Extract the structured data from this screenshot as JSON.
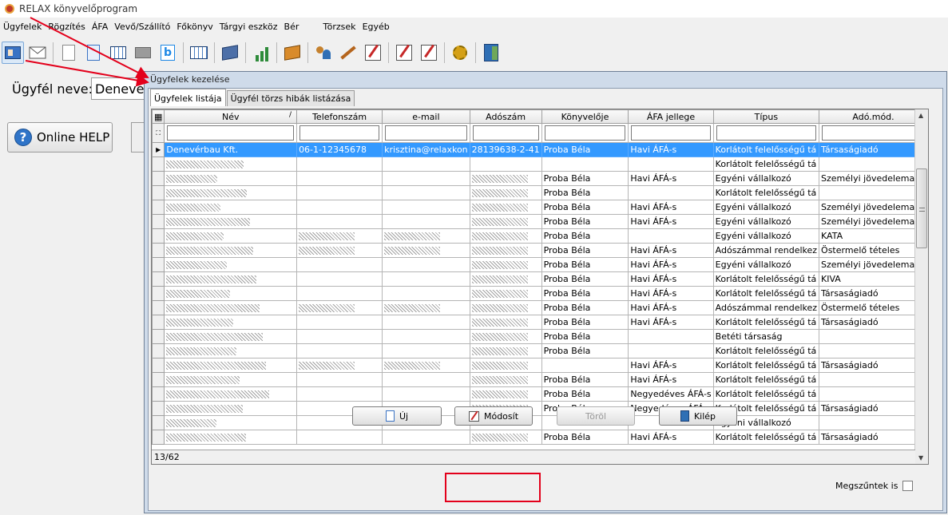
{
  "window": {
    "title": "RELAX könyvelőprogram"
  },
  "menu": [
    "Ügyfelek",
    "Rögzítés",
    "ÁFA",
    "Vevő/Szállító",
    "Főkönyv",
    "Tárgyi eszköz",
    "Bér",
    "Törzsek",
    "Egyéb"
  ],
  "toolbar_icons": [
    "client-card-icon",
    "envelope-icon",
    "document-icon",
    "documents-icon",
    "calculator-icon",
    "grey-box-icon",
    "b-document-icon",
    "table-icon",
    "blue-book-icon",
    "bar-chart-icon",
    "orange-book-icon",
    "people-icon",
    "magic-wand-icon",
    "edit-icon",
    "pen-red-icon",
    "pen-list-icon",
    "gear-icon",
    "exit-door-icon"
  ],
  "client": {
    "label": "Ügyfél neve:",
    "value": "Denevérbau Kft."
  },
  "help": {
    "label": "Online HELP"
  },
  "dialog": {
    "title": "Ügyfelek kezelése",
    "tabs": [
      "Ügyfelek listája",
      "Ügyfél törzs hibák listázása"
    ],
    "columns": [
      "Név",
      "Telefonszám",
      "e-mail",
      "Adószám",
      "Könyvelője",
      "ÁFA jellege",
      "Típus",
      "Adó.mód."
    ],
    "rows": [
      {
        "name": "Denevérbau Kft.",
        "phone": "06-1-12345678",
        "email": "krisztina@relaxkon",
        "tax": "28139638-2-41",
        "bookkeeper": "Proba Béla",
        "vat": "Havi ÁFÁ-s",
        "type": "Korlátolt felelősségű tá",
        "taxmode": "Társaságiadó"
      },
      {
        "name": "",
        "phone": "",
        "email": "",
        "tax": "",
        "bookkeeper": "",
        "vat": "",
        "type": "Korlátolt felelősségű tá",
        "taxmode": ""
      },
      {
        "name": "",
        "phone": "",
        "email": "",
        "tax": "",
        "bookkeeper": "Proba Béla",
        "vat": "Havi ÁFÁ-s",
        "type": "Egyéni vállalkozó",
        "taxmode": "Személyi jövedelemadó"
      },
      {
        "name": "",
        "phone": "",
        "email": "",
        "tax": "",
        "bookkeeper": "Proba Béla",
        "vat": "",
        "type": "Korlátolt felelősségű tá",
        "taxmode": ""
      },
      {
        "name": "",
        "phone": "",
        "email": "",
        "tax": "",
        "bookkeeper": "Proba Béla",
        "vat": "Havi ÁFÁ-s",
        "type": "Egyéni vállalkozó",
        "taxmode": "Személyi jövedelemadó"
      },
      {
        "name": "",
        "phone": "",
        "email": "",
        "tax": "",
        "bookkeeper": "Proba Béla",
        "vat": "Havi ÁFÁ-s",
        "type": "Egyéni vállalkozó",
        "taxmode": "Személyi jövedelemadó"
      },
      {
        "name": "",
        "phone": "",
        "email": "",
        "tax": "",
        "bookkeeper": "Proba Béla",
        "vat": "",
        "type": "Egyéni vállalkozó",
        "taxmode": "KATA"
      },
      {
        "name": "",
        "phone": "",
        "email": "",
        "tax": "",
        "bookkeeper": "Proba Béla",
        "vat": "Havi ÁFÁ-s",
        "type": "Adószámmal rendelkez",
        "taxmode": "Östermelő tételes"
      },
      {
        "name": "",
        "phone": "",
        "email": "",
        "tax": "",
        "bookkeeper": "Proba Béla",
        "vat": "Havi ÁFÁ-s",
        "type": "Egyéni vállalkozó",
        "taxmode": "Személyi jövedelemadó"
      },
      {
        "name": "",
        "phone": "",
        "email": "",
        "tax": "",
        "bookkeeper": "Proba Béla",
        "vat": "Havi ÁFÁ-s",
        "type": "Korlátolt felelősségű tá",
        "taxmode": "KIVA"
      },
      {
        "name": "",
        "phone": "",
        "email": "",
        "tax": "",
        "bookkeeper": "Proba Béla",
        "vat": "Havi ÁFÁ-s",
        "type": "Korlátolt felelősségű tá",
        "taxmode": "Társaságiadó"
      },
      {
        "name": "",
        "phone": "",
        "email": "",
        "tax": "",
        "bookkeeper": "Proba Béla",
        "vat": "Havi ÁFÁ-s",
        "type": "Adószámmal rendelkez",
        "taxmode": "Östermelő tételes"
      },
      {
        "name": "",
        "phone": "",
        "email": "",
        "tax": "",
        "bookkeeper": "Proba Béla",
        "vat": "Havi ÁFÁ-s",
        "type": "Korlátolt felelősségű tá",
        "taxmode": "Társaságiadó"
      },
      {
        "name": "",
        "phone": "",
        "email": "",
        "tax": "",
        "bookkeeper": "Proba Béla",
        "vat": "",
        "type": "Betéti társaság",
        "taxmode": ""
      },
      {
        "name": "",
        "phone": "",
        "email": "",
        "tax": "",
        "bookkeeper": "Proba Béla",
        "vat": "",
        "type": "Korlátolt felelősségű tá",
        "taxmode": ""
      },
      {
        "name": "",
        "phone": "",
        "email": "",
        "tax": "",
        "bookkeeper": "",
        "vat": "Havi ÁFÁ-s",
        "type": "Korlátolt felelősségű tá",
        "taxmode": "Társaságiadó"
      },
      {
        "name": "",
        "phone": "",
        "email": "",
        "tax": "",
        "bookkeeper": "Proba Béla",
        "vat": "Havi ÁFÁ-s",
        "type": "Korlátolt felelősségű tá",
        "taxmode": ""
      },
      {
        "name": "",
        "phone": "",
        "email": "",
        "tax": "",
        "bookkeeper": "Proba Béla",
        "vat": "Negyedéves ÁFÁ-s",
        "type": "Korlátolt felelősségű tá",
        "taxmode": ""
      },
      {
        "name": "",
        "phone": "",
        "email": "",
        "tax": "",
        "bookkeeper": "Proba Béla",
        "vat": "Negyedéves ÁFÁ-s",
        "type": "Korlátolt felelősségű tá",
        "taxmode": "Társaságiadó"
      },
      {
        "name": "",
        "phone": "",
        "email": "",
        "tax": "",
        "bookkeeper": "",
        "vat": "",
        "type": "Egyéni vállalkozó",
        "taxmode": ""
      },
      {
        "name": "",
        "phone": "",
        "email": "",
        "tax": "",
        "bookkeeper": "Proba Béla",
        "vat": "Havi ÁFÁ-s",
        "type": "Korlátolt felelősségű tá",
        "taxmode": "Társaságiadó"
      }
    ],
    "record_counter": "13/62",
    "buttons": {
      "new": "Új",
      "edit": "Módosít",
      "delete": "Töröl",
      "exit": "Kilép"
    },
    "discontinued_label": "Megszűntek is"
  },
  "colors": {
    "selection": "#3399ff",
    "annotation": "#e3001b"
  }
}
